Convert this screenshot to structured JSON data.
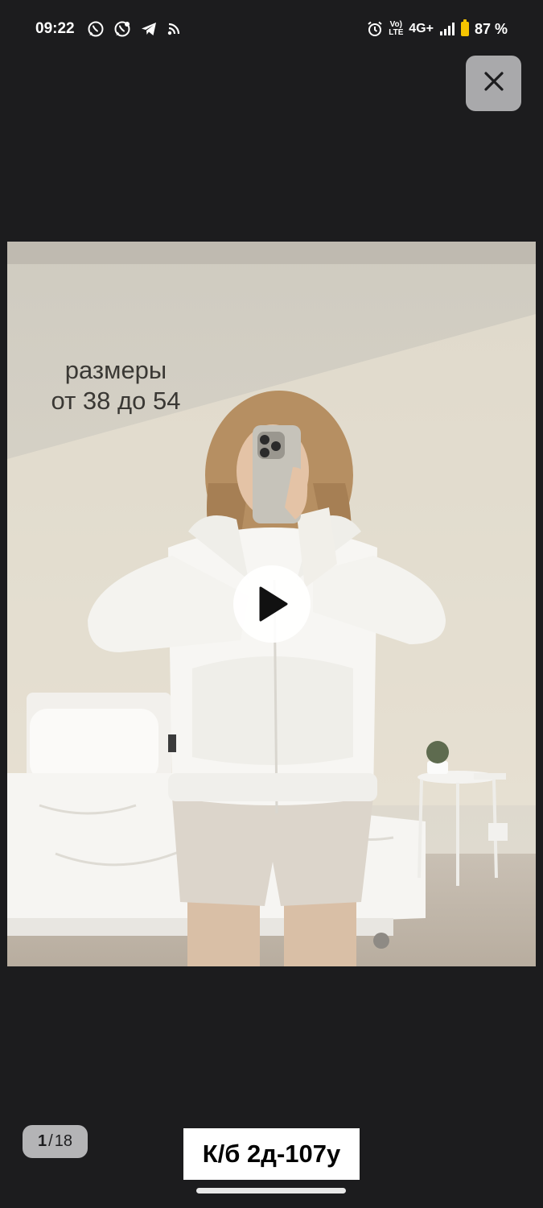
{
  "status_bar": {
    "time": "09:22",
    "left_icons": [
      "whatsapp-icon",
      "whatsapp-business-icon",
      "telegram-icon",
      "rss-icon"
    ],
    "volte_label": "Vo) LTE",
    "network": "4G+",
    "battery_percent": "87 %",
    "battery_level": 87,
    "battery_color": "#f5c400"
  },
  "viewer": {
    "close_icon": "close-icon",
    "photo_overlay": {
      "line1": "размеры",
      "line2": "от 38 до 54"
    },
    "play_icon": "play-icon",
    "page_counter": {
      "current": "1",
      "separator": "/",
      "total": "18"
    },
    "caption": "К/б 2д-107у"
  },
  "colors": {
    "background": "#1c1c1e",
    "button_gray": "#a9a9ab",
    "counter_bg": "#b4b4b6"
  }
}
